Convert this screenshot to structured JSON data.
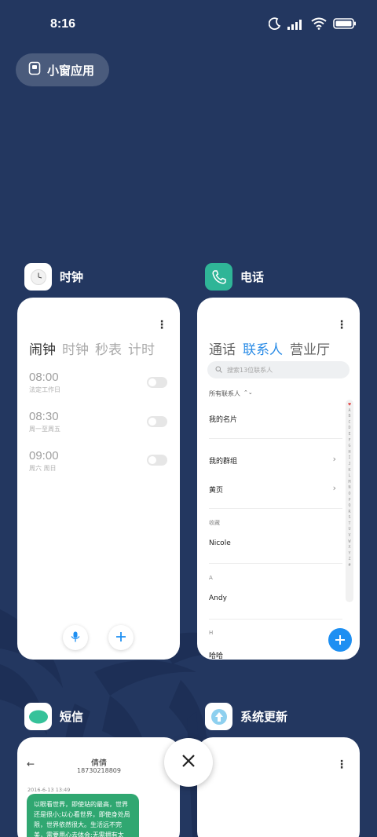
{
  "status_bar": {
    "time": "8:16",
    "icons": [
      "moon-icon",
      "signal-icon",
      "wifi-icon",
      "battery-icon"
    ]
  },
  "small_window": {
    "label": "小窗应用",
    "icon": "small-window-icon"
  },
  "apps": {
    "clock": {
      "name": "时钟",
      "tabs": [
        "闹钟",
        "时钟",
        "秒表",
        "计时"
      ],
      "alarms": [
        {
          "time": "08:00",
          "desc": "法定工作日"
        },
        {
          "time": "08:30",
          "desc": "周一至周五"
        },
        {
          "time": "09:00",
          "desc": "周六 周日"
        }
      ]
    },
    "phone": {
      "name": "电话",
      "tabs": [
        "通话",
        "联系人",
        "营业厅"
      ],
      "search_placeholder": "搜索13位联系人",
      "all_contacts": "所有联系人",
      "my_card": "我的名片",
      "my_groups": "我的群组",
      "yellow_pages": "黄页",
      "section_favorites": "收藏",
      "contact_nicole": "Nicole",
      "section_a": "A",
      "contact_andy": "Andy",
      "section_h": "H",
      "contact_haha": "哈哈",
      "alphabet": [
        "A",
        "B",
        "C",
        "D",
        "E",
        "F",
        "G",
        "H",
        "I",
        "J",
        "K",
        "L",
        "M",
        "N",
        "O",
        "P",
        "Q",
        "R",
        "S",
        "T",
        "U",
        "V",
        "W",
        "X",
        "Y",
        "Z",
        "#"
      ],
      "accent": "#1d8ff2"
    },
    "sms": {
      "name": "短信",
      "contact_name": "倩倩",
      "contact_number": "18730218809",
      "date": "2016-6-13 13:49",
      "message": "以眼看世界，即使站的最高，世界还是很小;以心看世界，即使身处局限，世界依然很大。生活远不完美，需要用心去体会;无需拥有太",
      "bubble_color": "#30a771"
    },
    "update": {
      "name": "系统更新"
    }
  },
  "background_color": "#233760"
}
